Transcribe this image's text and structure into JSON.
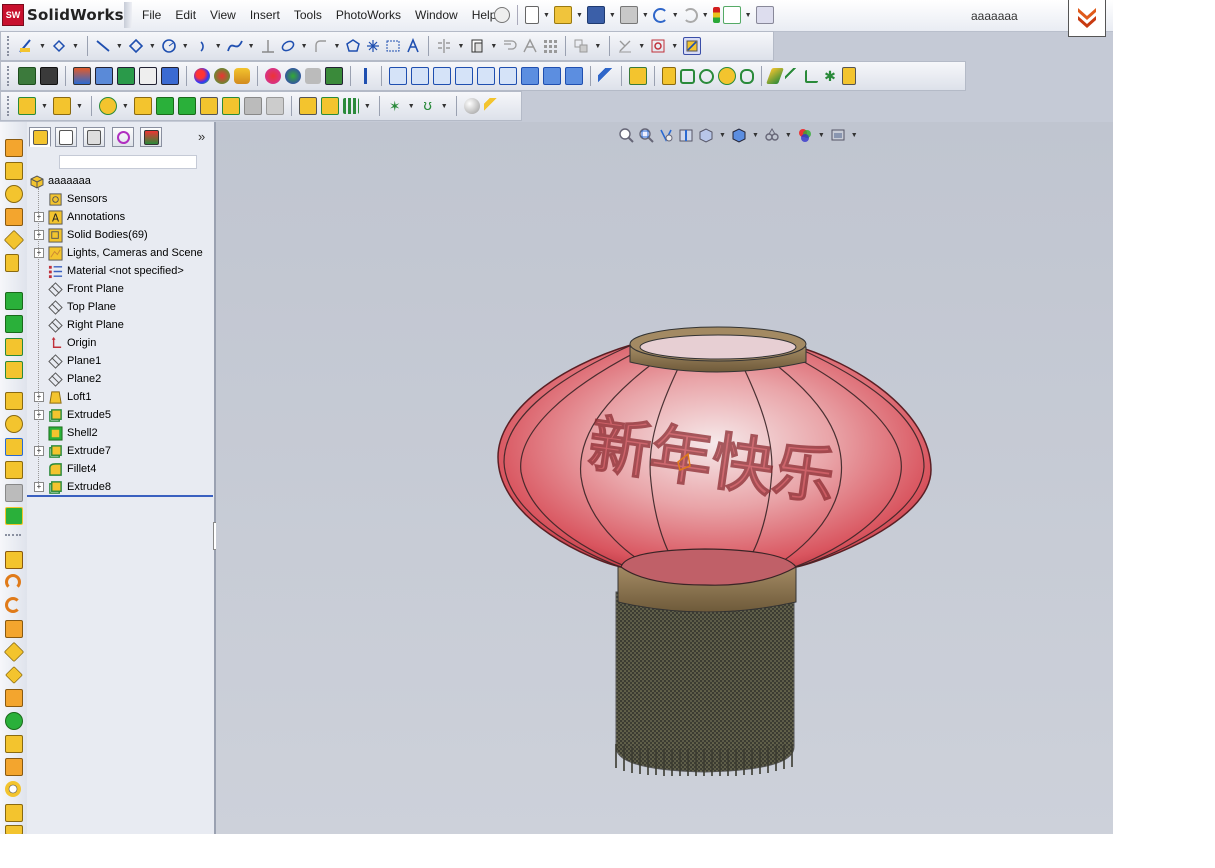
{
  "app": {
    "logo_badge": "SW",
    "logo_text": "SolidWorks",
    "document_name": "aaaaaaa"
  },
  "menu": [
    "File",
    "Edit",
    "View",
    "Insert",
    "Tools",
    "PhotoWorks",
    "Window",
    "Help"
  ],
  "feature_manager": {
    "root": "aaaaaaa",
    "items": [
      {
        "label": "Sensors",
        "icon": "sensors-icon",
        "expandable": false
      },
      {
        "label": "Annotations",
        "icon": "annotations-icon",
        "expandable": true
      },
      {
        "label": "Solid Bodies(69)",
        "icon": "solid-bodies-icon",
        "expandable": true
      },
      {
        "label": "Lights, Cameras and Scene",
        "icon": "lights-icon",
        "expandable": true
      },
      {
        "label": "Material <not specified>",
        "icon": "material-icon",
        "expandable": false
      },
      {
        "label": "Front Plane",
        "icon": "plane-icon",
        "expandable": false
      },
      {
        "label": "Top Plane",
        "icon": "plane-icon",
        "expandable": false
      },
      {
        "label": "Right Plane",
        "icon": "plane-icon",
        "expandable": false
      },
      {
        "label": "Origin",
        "icon": "origin-icon",
        "expandable": false
      },
      {
        "label": "Plane1",
        "icon": "plane-icon",
        "expandable": false
      },
      {
        "label": "Plane2",
        "icon": "plane-icon",
        "expandable": false
      },
      {
        "label": "Loft1",
        "icon": "loft-icon",
        "expandable": true
      },
      {
        "label": "Extrude5",
        "icon": "extrude-icon",
        "expandable": true
      },
      {
        "label": "Shell2",
        "icon": "shell-icon",
        "expandable": false
      },
      {
        "label": "Extrude7",
        "icon": "extrude-icon",
        "expandable": true
      },
      {
        "label": "Fillet4",
        "icon": "fillet-icon",
        "expandable": false
      },
      {
        "label": "Extrude8",
        "icon": "extrude-icon",
        "expandable": true
      }
    ]
  },
  "model": {
    "characters": "新年快乐"
  },
  "colors": {
    "lantern_red": "#d9555f",
    "band_gold": "#8c7451",
    "tassel": "#4a4a3c",
    "accent_orange": "#e07b1a"
  }
}
